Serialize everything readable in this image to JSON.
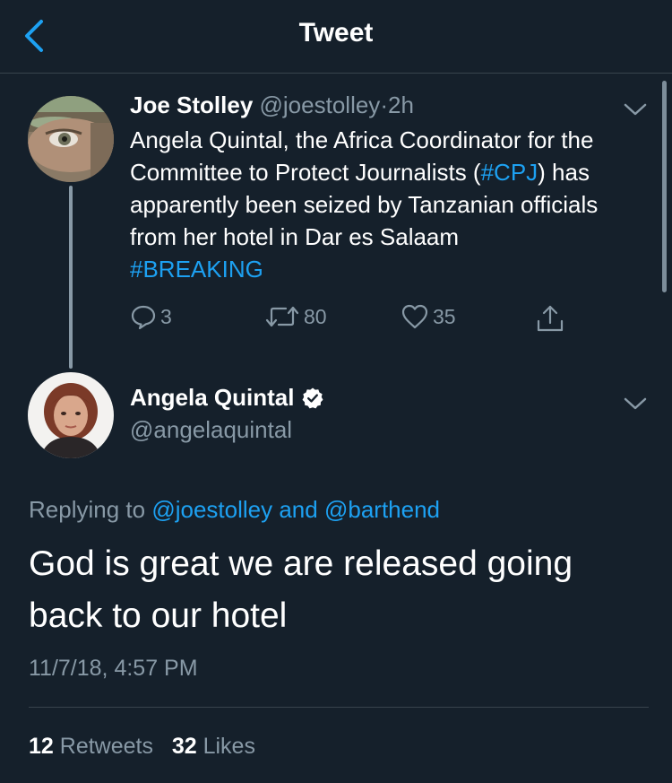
{
  "header": {
    "title": "Tweet",
    "back_icon": "chevron-left-icon"
  },
  "colors": {
    "background": "#15202b",
    "accent": "#1da1f2",
    "muted": "#8899a6",
    "text": "#ffffff",
    "divider": "#38444d"
  },
  "tweet1": {
    "name": "Joe Stolley",
    "handle": "@joestolley",
    "separator": "·",
    "time": "2h",
    "text_1": "Angela Quintal, the Africa Coordinator for the Committee to Protect Journalists (",
    "hashtag_cpj": "#CPJ",
    "text_2": ") has apparently  been seized by Tanzanian officials from her hotel in Dar es Salaam",
    "hashtag_breaking": "#BREAKING",
    "actions": {
      "replies": "3",
      "retweets": "80",
      "likes": "35"
    }
  },
  "tweet2": {
    "name": "Angela Quintal",
    "verified_icon": "verified-badge-icon",
    "handle": "@angelaquintal",
    "replying_prefix": "Replying to",
    "reply_user_1": "@joestolley",
    "reply_and": "and",
    "reply_user_2": "@barthend",
    "text": "God is great we are released going back to our hotel",
    "timestamp": "11/7/18, 4:57 PM",
    "retweet_count": "12",
    "retweet_label": "Retweets",
    "like_count": "32",
    "like_label": "Likes"
  }
}
